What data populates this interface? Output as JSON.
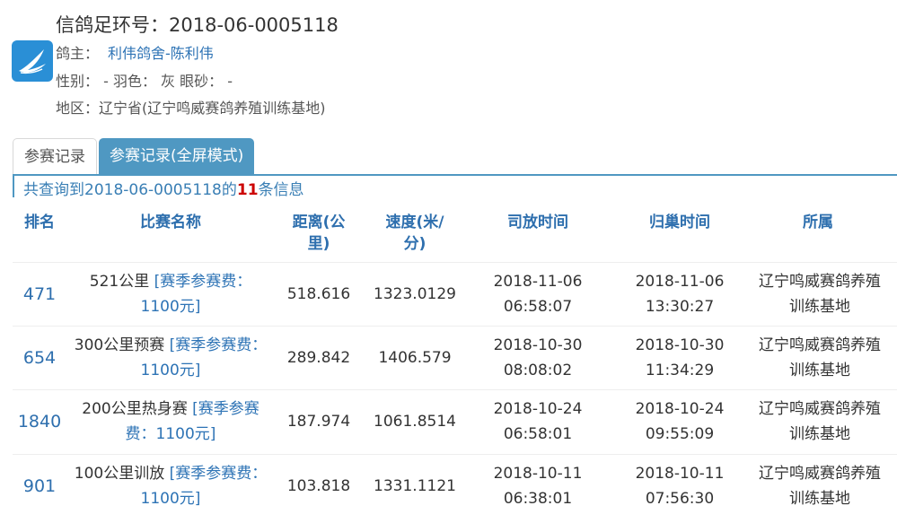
{
  "header": {
    "ring_title": "信鸽足环号：2018-06-0005118",
    "owner_label": "鸽主：",
    "owner_name": "利伟鸽舍-陈利伟",
    "attrs_text": "性别：  - 羽色： 灰 眼砂： -",
    "region_text": "地区：辽宁省(辽宁鸣威赛鸽养殖训练基地)",
    "logo_icon": "dove-logo-icon",
    "logo_color": "#2a8fd6"
  },
  "tabs": [
    {
      "label": "参赛记录",
      "active": false
    },
    {
      "label": "参赛记录(全屏模式)",
      "active": true
    }
  ],
  "summary": {
    "prefix": "共查询到2018-06-0005118的",
    "count": "11",
    "suffix": "条信息"
  },
  "table": {
    "columns": [
      "排名",
      "比赛名称",
      "距离(公里)",
      "速度(米/分)",
      "司放时间",
      "归巢时间",
      "所属"
    ],
    "header_lines": {
      "distance": [
        "距离(公",
        "里)"
      ],
      "speed": [
        "速度(米/",
        "分)"
      ]
    },
    "rows": [
      {
        "rank": "471",
        "race_name": "521公里",
        "race_tag": "[赛季参赛费：1100元]",
        "distance": "518.616",
        "speed": "1323.0129",
        "release_date": "2018-11-06",
        "release_time": "06:58:07",
        "return_date": "2018-11-06",
        "return_time": "13:30:27",
        "affiliation": "辽宁鸣威赛鸽养殖训练基地"
      },
      {
        "rank": "654",
        "race_name": "300公里预赛",
        "race_tag": "[赛季参赛费：1100元]",
        "distance": "289.842",
        "speed": "1406.579",
        "release_date": "2018-10-30",
        "release_time": "08:08:02",
        "return_date": "2018-10-30",
        "return_time": "11:34:29",
        "affiliation": "辽宁鸣威赛鸽养殖训练基地"
      },
      {
        "rank": "1840",
        "race_name": "200公里热身赛",
        "race_tag": "[赛季参赛费：1100元]",
        "distance": "187.974",
        "speed": "1061.8514",
        "release_date": "2018-10-24",
        "release_time": "06:58:01",
        "return_date": "2018-10-24",
        "return_time": "09:55:09",
        "affiliation": "辽宁鸣威赛鸽养殖训练基地"
      },
      {
        "rank": "901",
        "race_name": "100公里训放",
        "race_tag": "[赛季参赛费：1100元]",
        "distance": "103.818",
        "speed": "1331.1121",
        "release_date": "2018-10-11",
        "release_time": "06:38:01",
        "return_date": "2018-10-11",
        "return_time": "07:56:30",
        "affiliation": "辽宁鸣威赛鸽养殖训练基地"
      }
    ]
  }
}
